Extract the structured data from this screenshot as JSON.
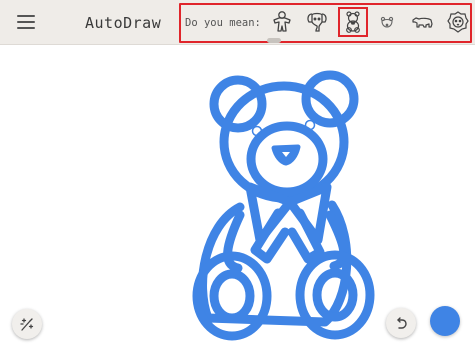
{
  "app": {
    "title": "AutoDraw"
  },
  "suggestions": {
    "label": "Do you mean:",
    "items": [
      {
        "name": "gingerbread",
        "selected": false
      },
      {
        "name": "elephant-face",
        "selected": false
      },
      {
        "name": "teddy-bear",
        "selected": true
      },
      {
        "name": "polar-bear-face",
        "selected": false
      },
      {
        "name": "polar-bear",
        "selected": false
      },
      {
        "name": "lion-face",
        "selected": false
      }
    ]
  },
  "drawing": {
    "subject": "teddy-bear",
    "stroke_color": "#3f84e5"
  },
  "colors": {
    "accent": "#3f84e5",
    "highlight": "#e0252b",
    "toolbar_bg": "#efece8"
  },
  "icons": {
    "menu": "menu-icon",
    "magic": "magic-wand-icon",
    "undo": "undo-icon"
  }
}
